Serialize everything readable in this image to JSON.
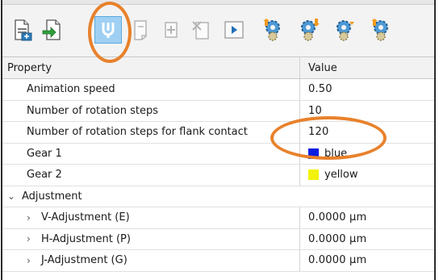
{
  "toolbar": {
    "buttons": [
      {
        "name": "import-icon"
      },
      {
        "name": "export-icon"
      },
      {
        "name": "clear-icon"
      },
      {
        "name": "document-icon"
      },
      {
        "name": "add-icon"
      },
      {
        "name": "remove-icon"
      },
      {
        "name": "play-icon"
      },
      {
        "name": "gear-up-icon"
      },
      {
        "name": "gear-down-icon"
      },
      {
        "name": "gear-orange-icon"
      },
      {
        "name": "gear-extra-icon"
      }
    ]
  },
  "grid": {
    "header": {
      "property": "Property",
      "value": "Value"
    },
    "rows": [
      {
        "label": "Animation speed",
        "value": "0.50"
      },
      {
        "label": "Number of rotation steps",
        "value": "10"
      },
      {
        "label": "Number of rotation steps for flank contact",
        "value": "120"
      },
      {
        "label": "Gear 1",
        "value": "blue",
        "color": "#0a1ee0"
      },
      {
        "label": "Gear 2",
        "value": "yellow",
        "color": "#f2f20a"
      },
      {
        "label": "Adjustment",
        "value": "",
        "expanded": true
      },
      {
        "label": "V-Adjustment (E)",
        "value": "0.0000 µm"
      },
      {
        "label": "H-Adjustment (P)",
        "value": "0.0000 µm"
      },
      {
        "label": "J-Adjustment (G)",
        "value": "0.0000 µm"
      }
    ]
  },
  "colors": {
    "highlight": "#e8812b",
    "selected_button": "#9fd0f3"
  }
}
